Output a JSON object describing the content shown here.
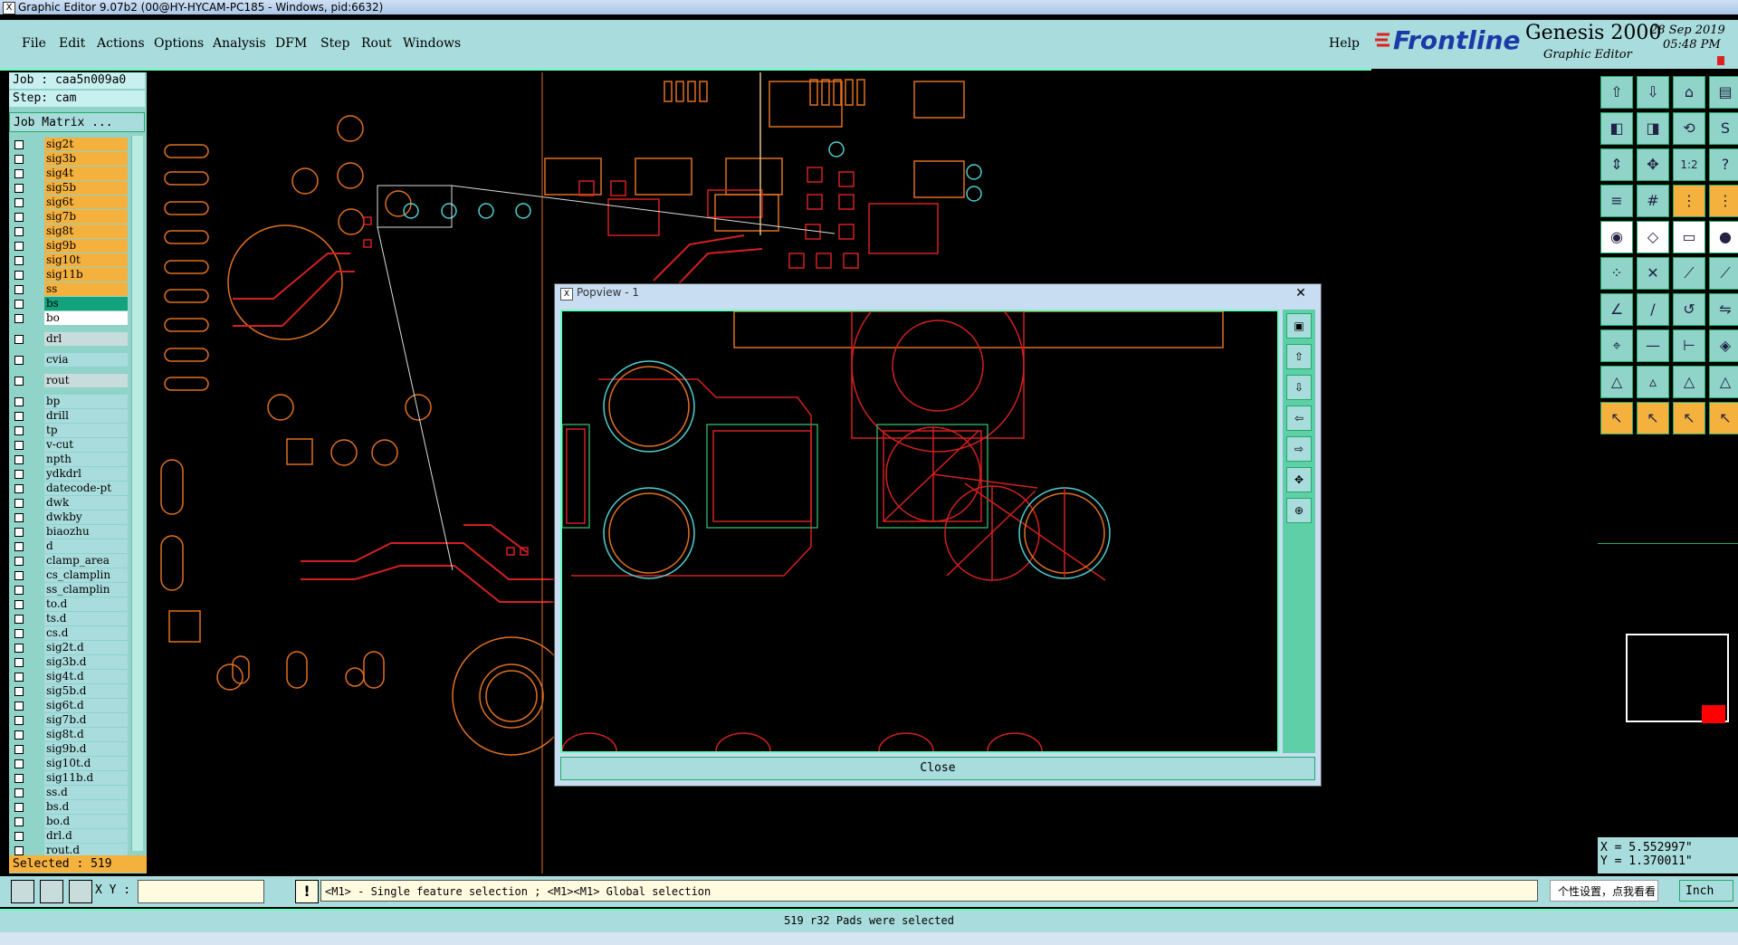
{
  "window": {
    "title": "Graphic Editor 9.07b2 (00@HY-HYCAM-PC185 - Windows, pid:6632)"
  },
  "menu": {
    "items": [
      "File",
      "Edit",
      "Actions",
      "Options",
      "Analysis",
      "DFM",
      "Step",
      "Rout",
      "Windows"
    ],
    "help": "Help"
  },
  "brand": {
    "logo": "Frontline",
    "product": "Genesis 2000",
    "subtitle": "Graphic Editor",
    "date": "28  Sep  2019",
    "time": "05:48  PM"
  },
  "job": {
    "job_line": "Job : caa5n009a0",
    "step_line": "Step: cam",
    "matrix_button": "Job Matrix ..."
  },
  "layers": [
    {
      "name": "sig2t",
      "style": "or"
    },
    {
      "name": "sig3b",
      "style": "or"
    },
    {
      "name": "sig4t",
      "style": "or"
    },
    {
      "name": "sig5b",
      "style": "or"
    },
    {
      "name": "sig6t",
      "style": "or"
    },
    {
      "name": "sig7b",
      "style": "or"
    },
    {
      "name": "sig8t",
      "style": "or"
    },
    {
      "name": "sig9b",
      "style": "or"
    },
    {
      "name": "sig10t",
      "style": "or"
    },
    {
      "name": "sig11b",
      "style": "or"
    },
    {
      "name": "ss",
      "style": "or"
    },
    {
      "name": "bs",
      "style": "gr"
    },
    {
      "name": "bo",
      "style": "wh"
    },
    {
      "name": "drl",
      "style": "gy"
    },
    {
      "name": "cvia",
      "style": "cy"
    },
    {
      "name": "rout",
      "style": "gy"
    },
    {
      "name": "bp",
      "style": "cy"
    },
    {
      "name": "drill",
      "style": "cy"
    },
    {
      "name": "tp",
      "style": "cy"
    },
    {
      "name": "v-cut",
      "style": "cy"
    },
    {
      "name": "npth",
      "style": "cy"
    },
    {
      "name": "ydkdrl",
      "style": "cy"
    },
    {
      "name": "datecode-pt",
      "style": "cy"
    },
    {
      "name": "dwk",
      "style": "cy"
    },
    {
      "name": "dwkby",
      "style": "cy"
    },
    {
      "name": "biaozhu",
      "style": "cy"
    },
    {
      "name": "d",
      "style": "cy"
    },
    {
      "name": "clamp_area",
      "style": "cy"
    },
    {
      "name": "cs_clamplin",
      "style": "cy"
    },
    {
      "name": "ss_clamplin",
      "style": "cy"
    },
    {
      "name": "to.d",
      "style": "cy"
    },
    {
      "name": "ts.d",
      "style": "cy"
    },
    {
      "name": "cs.d",
      "style": "cy"
    },
    {
      "name": "sig2t.d",
      "style": "cy"
    },
    {
      "name": "sig3b.d",
      "style": "cy"
    },
    {
      "name": "sig4t.d",
      "style": "cy"
    },
    {
      "name": "sig5b.d",
      "style": "cy"
    },
    {
      "name": "sig6t.d",
      "style": "cy"
    },
    {
      "name": "sig7b.d",
      "style": "cy"
    },
    {
      "name": "sig8t.d",
      "style": "cy"
    },
    {
      "name": "sig9b.d",
      "style": "cy"
    },
    {
      "name": "sig10t.d",
      "style": "cy"
    },
    {
      "name": "sig11b.d",
      "style": "cy"
    },
    {
      "name": "ss.d",
      "style": "cy"
    },
    {
      "name": "bs.d",
      "style": "cy"
    },
    {
      "name": "bo.d",
      "style": "cy"
    },
    {
      "name": "drl.d",
      "style": "cy"
    },
    {
      "name": "rout.d",
      "style": "cy"
    }
  ],
  "selected": "Selected : 519",
  "coords": {
    "x": "X = 5.552997\"",
    "y": "Y = 1.370011\""
  },
  "bottom": {
    "xy_label": "X Y :",
    "xy_value": "",
    "hint": "<M1> - Single feature selection ; <M1><M1> Global selection",
    "units": "Inch",
    "ime_tip": "个性设置，点我看看"
  },
  "status": "519 r32 Pads were selected",
  "popview": {
    "title": "Popview - 1",
    "close_label": "Close"
  },
  "colors": {
    "accent": "#a9dcdc",
    "layer_orange": "#f5b13e",
    "copper_red": "#d42020",
    "pad_orange": "#e07020",
    "drill_cyan": "#4fd0d0"
  }
}
